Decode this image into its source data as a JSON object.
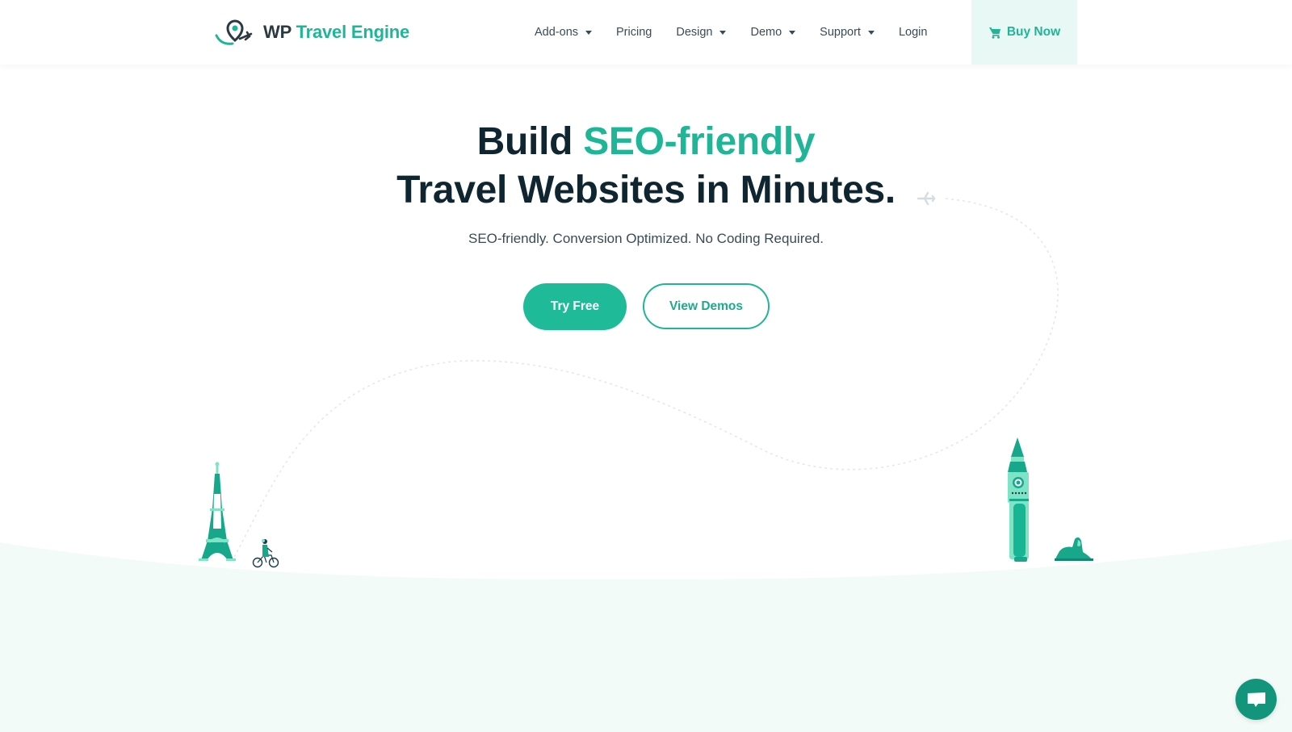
{
  "header": {
    "logo": {
      "prefix": "WP",
      "brand": "Travel Engine"
    },
    "nav": [
      {
        "label": "Add-ons",
        "has_dropdown": true
      },
      {
        "label": "Pricing",
        "has_dropdown": false
      },
      {
        "label": "Design",
        "has_dropdown": true
      },
      {
        "label": "Demo",
        "has_dropdown": true
      },
      {
        "label": "Support",
        "has_dropdown": true
      },
      {
        "label": "Login",
        "has_dropdown": false
      }
    ],
    "buy_now": {
      "label": "Buy Now",
      "icon": "cart-icon"
    }
  },
  "hero": {
    "title_line1_plain": "Build ",
    "title_line1_accent": "SEO-friendly",
    "title_line2": "Travel Websites in Minutes.",
    "subtitle": "SEO-friendly. Conversion Optimized. No Coding Required.",
    "primary_cta": "Try Free",
    "secondary_cta": "View Demos"
  },
  "illustrations": [
    "eiffel-tower",
    "cyclist",
    "big-ben",
    "sphinx",
    "airplane",
    "dotted-flight-path"
  ],
  "chat": {
    "icon": "chat-bubble-icon"
  },
  "colors": {
    "brand": "#1fb597",
    "brand_dark": "#12957b",
    "heading": "#0f2530",
    "text": "#3b4b55",
    "buy_bg": "#e8f8f4",
    "ground": "#f3fbf9"
  }
}
